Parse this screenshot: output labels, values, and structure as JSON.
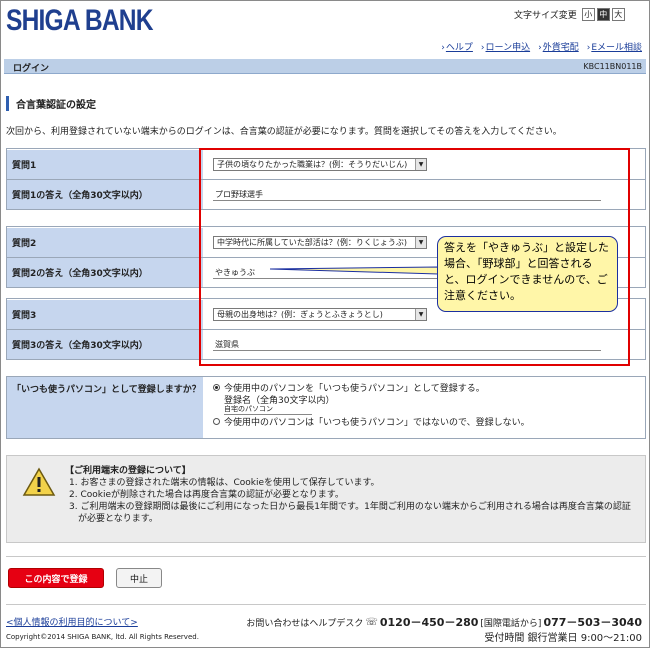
{
  "header": {
    "logo": "SHIGA BANK",
    "font_size_label": "文字サイズ変更",
    "font_sizes": [
      "小",
      "中",
      "大"
    ],
    "font_size_selected": "中",
    "links": [
      "ヘルプ",
      "ローン申込",
      "外貨宅配",
      "Eメール相談"
    ]
  },
  "titlebar": {
    "title": "ログイン",
    "code": "KBC11BN011B"
  },
  "section_title": "合言葉認証の設定",
  "intro": "次回から、利用登録されていない端末からのログインは、合言葉の認証が必要になります。質問を選択してその答えを入力してください。",
  "questions": [
    {
      "q_label": "質問1",
      "q_value": "子供の頃なりたかった職業は？(例：そうりだいじん)",
      "a_label": "質問1の答え（全角30文字以内）",
      "a_value": "プロ野球選手"
    },
    {
      "q_label": "質問2",
      "q_value": "中学時代に所属していた部活は？(例：りくじょうぶ)",
      "a_label": "質問2の答え（全角30文字以内）",
      "a_value": "やきゅうぶ"
    },
    {
      "q_label": "質問3",
      "q_value": "母親の出身地は？(例：ぎょうとふきょうとし)",
      "a_label": "質問3の答え（全角30文字以内）",
      "a_value": "滋賀県"
    }
  ],
  "callout": "答えを「やきゅうぶ」と設定した場合、「野球部」と回答されると、ログインできませんので、ご注意ください。",
  "registration": {
    "label": "「いつも使うパソコン」として登録しますか？",
    "option_yes": "今使用中のパソコンを「いつも使うパソコン」として登録する。",
    "name_label": "登録名（全角30文字以内）",
    "name_value": "自宅のパソコン",
    "option_no": "今使用中のパソコンは「いつも使うパソコン」ではないので、登録しない。",
    "selected": "yes"
  },
  "notice": {
    "title": "【ご利用端末の登録について】",
    "items": [
      "1. お客さまの登録された端末の情報は、Cookieを使用して保存しています。",
      "2. Cookieが削除された場合は再度合言葉の認証が必要となります。",
      "3. ご利用端末の登録期間は最後にご利用になった日から最長1年間です。1年間ご利用のない端末からご利用される場合は再度合言葉の認証が必要となります。"
    ]
  },
  "buttons": {
    "submit": "この内容で登録",
    "cancel": "中止"
  },
  "footer": {
    "privacy_link": "<個人情報の利用目的について>",
    "copyright": "Copyright©2014 SHIGA BANK, ltd. All Rights Reserved.",
    "help_text": "お問い合わせはヘルプデスク",
    "help_phone": "0120－450－280",
    "intl_label": "[国際電話から]",
    "intl_phone": "077－503－3040",
    "hours": "受付時間 銀行営業日 9:00～21:00"
  },
  "colors": {
    "brand": "#1f3f8f",
    "label_bg": "#c6d6ee",
    "accent_red": "#e60012",
    "callout_bg": "#fff6a8"
  }
}
